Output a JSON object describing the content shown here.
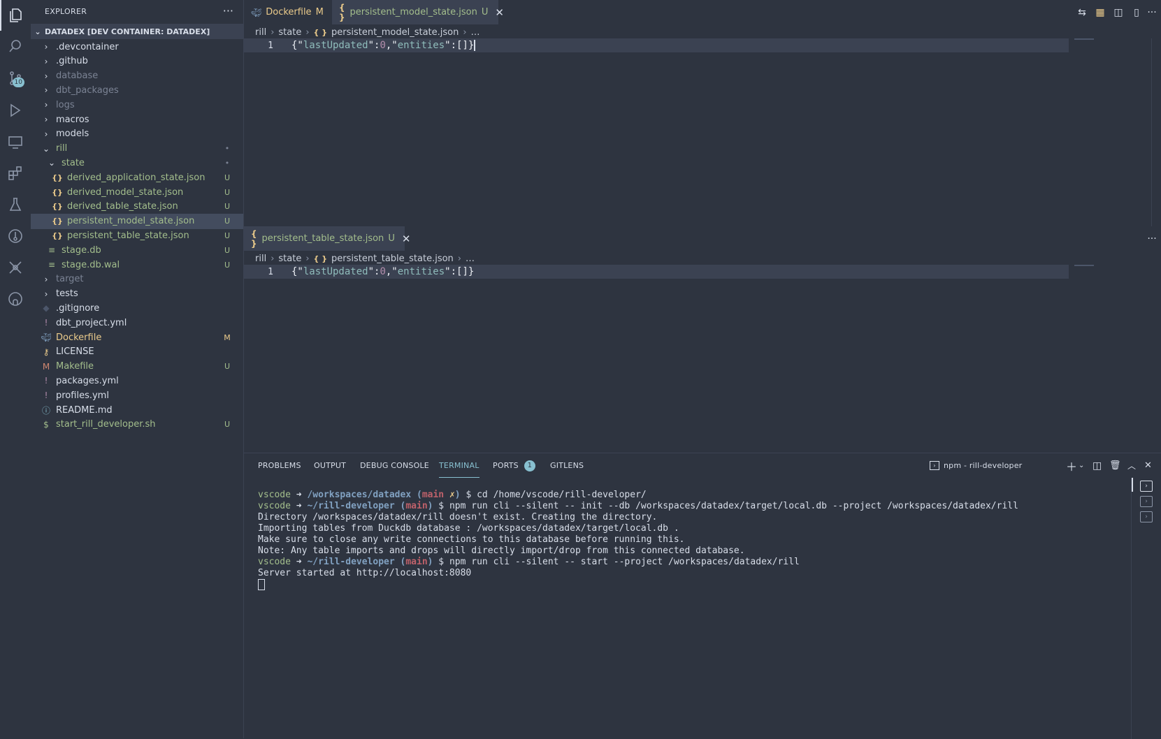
{
  "activity_bar": {
    "items": [
      {
        "name": "explorer-icon",
        "active": true
      },
      {
        "name": "search-icon"
      },
      {
        "name": "source-control-icon",
        "badge": "10"
      },
      {
        "name": "run-debug-icon"
      },
      {
        "name": "remote-explorer-icon"
      },
      {
        "name": "extensions-icon"
      },
      {
        "name": "testing-icon"
      },
      {
        "name": "gitlens-icon"
      },
      {
        "name": "tools-icon"
      },
      {
        "name": "github-icon"
      }
    ]
  },
  "sidebar": {
    "title": "EXPLORER",
    "more": "···",
    "section": "DATADEX [DEV CONTAINER: DATADEX]",
    "tree": [
      {
        "label": ".devcontainer",
        "kind": "folder",
        "depth": 1,
        "color": "#d8dee9",
        "deco": ""
      },
      {
        "label": ".github",
        "kind": "folder",
        "depth": 1,
        "color": "#d8dee9",
        "deco": ""
      },
      {
        "label": "database",
        "kind": "folder",
        "depth": 1,
        "color": "#7b8394",
        "deco": ""
      },
      {
        "label": "dbt_packages",
        "kind": "folder",
        "depth": 1,
        "color": "#7b8394",
        "deco": ""
      },
      {
        "label": "logs",
        "kind": "folder",
        "depth": 1,
        "color": "#7b8394",
        "deco": ""
      },
      {
        "label": "macros",
        "kind": "folder",
        "depth": 1,
        "color": "#d8dee9",
        "deco": ""
      },
      {
        "label": "models",
        "kind": "folder",
        "depth": 1,
        "color": "#d8dee9",
        "deco": ""
      },
      {
        "label": "rill",
        "kind": "folder-open",
        "depth": 1,
        "color": "#a3be8c",
        "deco": "•"
      },
      {
        "label": "state",
        "kind": "folder-open",
        "depth": 2,
        "color": "#a3be8c",
        "deco": "•"
      },
      {
        "label": "derived_application_state.json",
        "kind": "json",
        "depth": 3,
        "color": "#a3be8c",
        "deco": "U"
      },
      {
        "label": "derived_model_state.json",
        "kind": "json",
        "depth": 3,
        "color": "#a3be8c",
        "deco": "U"
      },
      {
        "label": "derived_table_state.json",
        "kind": "json",
        "depth": 3,
        "color": "#a3be8c",
        "deco": "U"
      },
      {
        "label": "persistent_model_state.json",
        "kind": "json",
        "depth": 3,
        "color": "#a3be8c",
        "deco": "U",
        "selected": true
      },
      {
        "label": "persistent_table_state.json",
        "kind": "json",
        "depth": 3,
        "color": "#a3be8c",
        "deco": "U"
      },
      {
        "label": "stage.db",
        "kind": "file",
        "depth": 2,
        "color": "#a3be8c",
        "deco": "U"
      },
      {
        "label": "stage.db.wal",
        "kind": "file",
        "depth": 2,
        "color": "#a3be8c",
        "deco": "U"
      },
      {
        "label": "target",
        "kind": "folder",
        "depth": 1,
        "color": "#7b8394",
        "deco": ""
      },
      {
        "label": "tests",
        "kind": "folder",
        "depth": 1,
        "color": "#d8dee9",
        "deco": ""
      },
      {
        "label": ".gitignore",
        "kind": "git",
        "depth": 1,
        "color": "#d8dee9",
        "deco": ""
      },
      {
        "label": "dbt_project.yml",
        "kind": "yaml",
        "depth": 1,
        "color": "#d8dee9",
        "deco": ""
      },
      {
        "label": "Dockerfile",
        "kind": "docker",
        "depth": 1,
        "color": "#ebcb8b",
        "deco": "M"
      },
      {
        "label": "LICENSE",
        "kind": "license",
        "depth": 1,
        "color": "#d8dee9",
        "deco": ""
      },
      {
        "label": "Makefile",
        "kind": "make",
        "depth": 1,
        "color": "#a3be8c",
        "deco": "U"
      },
      {
        "label": "packages.yml",
        "kind": "yaml",
        "depth": 1,
        "color": "#d8dee9",
        "deco": ""
      },
      {
        "label": "profiles.yml",
        "kind": "yaml",
        "depth": 1,
        "color": "#d8dee9",
        "deco": ""
      },
      {
        "label": "README.md",
        "kind": "info",
        "depth": 1,
        "color": "#d8dee9",
        "deco": ""
      },
      {
        "label": "start_rill_developer.sh",
        "kind": "shell",
        "depth": 1,
        "color": "#a3be8c",
        "deco": "U"
      }
    ]
  },
  "editor_top": {
    "tabs": [
      {
        "label": "Dockerfile",
        "deco": "M",
        "color": "#ebcb8b",
        "icon": "docker",
        "active": false
      },
      {
        "label": "persistent_model_state.json",
        "deco": "U",
        "color": "#a3be8c",
        "icon": "json",
        "active": true,
        "close": "✕"
      }
    ],
    "breadcrumb": {
      "seg1": "rill",
      "seg2": "state",
      "file": "persistent_model_state.json",
      "tail": "…"
    },
    "line_number": "1"
  },
  "editor_bottom": {
    "tabs": [
      {
        "label": "persistent_table_state.json",
        "deco": "U",
        "color": "#a3be8c",
        "icon": "json",
        "active": true,
        "close": "✕"
      }
    ],
    "breadcrumb": {
      "seg1": "rill",
      "seg2": "state",
      "file": "persistent_table_state.json",
      "tail": "…"
    },
    "line_number": "1",
    "more": "···"
  },
  "panel": {
    "tabs": {
      "problems": "PROBLEMS",
      "output": "OUTPUT",
      "debug_console": "DEBUG CONSOLE",
      "terminal": "TERMINAL",
      "ports": "PORTS",
      "ports_count": "1",
      "gitlens": "GITLENS"
    },
    "terminal_name": "npm - rill-developer",
    "terminal": {
      "l1_user": "vscode",
      "l1_arrow": " ➜ ",
      "l1_path": "/workspaces/datadex",
      "l1_branch": "main",
      "l1_x": "✗",
      "l1_cmd": " $ cd /home/vscode/rill-developer/",
      "l2_user": "vscode",
      "l2_arrow": " ➜ ",
      "l2_path": "~/rill-developer",
      "l2_branch": "main",
      "l2_cmd": " $ npm run cli --silent -- init --db /workspaces/datadex/target/local.db --project /workspaces/datadex/rill",
      "l3": "Directory /workspaces/datadex/rill doesn't exist. Creating the directory.",
      "l4": "Importing tables from Duckdb database : /workspaces/datadex/target/local.db .",
      "l5": "Make sure to close any write connections to this database before running this.",
      "l6": "Note: Any table imports and drops will directly import/drop from this connected database.",
      "l7_user": "vscode",
      "l7_arrow": " ➜ ",
      "l7_path": "~/rill-developer",
      "l7_branch": "main",
      "l7_cmd": " $ npm run cli --silent -- start --project /workspaces/datadex/rill",
      "l8": "Server started at http://localhost:8080"
    }
  }
}
